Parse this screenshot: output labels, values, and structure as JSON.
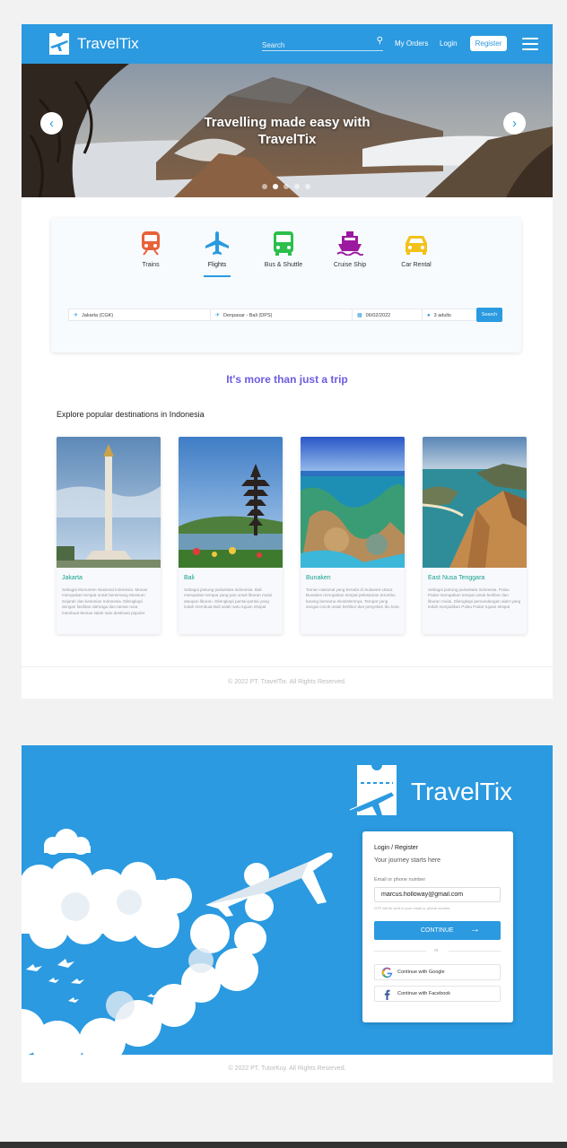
{
  "header": {
    "brand": "TravelTix",
    "search_placeholder": "Search",
    "my_orders": "My Orders",
    "login": "Login",
    "register": "Register"
  },
  "hero": {
    "title_line1": "Travelling made easy with",
    "title_line2": "TravelTix",
    "dots": 5,
    "active_dot": 2
  },
  "booking": {
    "modes": [
      {
        "label": "Trains",
        "color": "#e8623a"
      },
      {
        "label": "Flights",
        "color": "#2b9ae0"
      },
      {
        "label": "Bus & Shuttle",
        "color": "#2bbf4b"
      },
      {
        "label": "Cruise Ship",
        "color": "#9c1aa0"
      },
      {
        "label": "Car Rental",
        "color": "#f2c21b"
      }
    ],
    "active_mode": "Flights",
    "from": "Jakarta (CGK)",
    "to": "Denpasar - Bali (DPS)",
    "date": "06/02/2022",
    "passengers": "3 adults",
    "search_button": "Search"
  },
  "tagline": "It's more than just a trip",
  "explore": {
    "title": "Explore popular destinations in Indonesia",
    "cards": [
      {
        "name": "Jakarta",
        "desc": "Sebagai Monumen Nasional Indonesia. Monas merupakan tempat untuk bersenang Museum Sejarah dan kesenian Indonesia. Dilengkapi dengan fasilitas olahraga dan taman rusa membuat Monas salah satu destinasi populer"
      },
      {
        "name": "Bali",
        "desc": "Sebagai jantung pariwisata Indonesia. Bali merupakan tempat yang pas untuk liburan mulai ataupun liburan. Dilengkapi pantai-pantai yang indah membuat Bali salah satu tujuan ekspat"
      },
      {
        "name": "Bunaken",
        "desc": "Taman nasional yang berada di Sulawesi Utara. Bunaken merupakan tempat pelestarian terumbu karang bersama ekosistemnya. Tempat yang sangat cocok untuk berlibur dan penyelam ibu kota"
      },
      {
        "name": "East Nusa Tenggara",
        "desc": "Sebagai jantung pariwisata Indonesia. Pulau Padar merupakan tempat untuk berlibur dan liburan mulai. Dilengkapi pemandangan alam yang indah menjadikan Pulau Padar tujuan ekspat"
      }
    ]
  },
  "footer1": "© 2022 PT. TravelTix. All Rights Reserved.",
  "login": {
    "brand": "TravelTix",
    "title": "Login / Register",
    "subtitle": "Your journey starts here",
    "field_label": "Email or phone number",
    "field_value": "marcus.holloway@gmail.com",
    "hint": "OTP will be sent to your email or phone number",
    "continue": "CONTINUE",
    "or": "or",
    "google": "Continue with Google",
    "facebook": "Continue with Facebook"
  },
  "footer2": "© 2022 PT. TutorKuy. All Rights Reserved.",
  "colors": {
    "primary": "#2b9ae0",
    "tagline": "#6b5ce0",
    "card_title": "#18a18d"
  }
}
